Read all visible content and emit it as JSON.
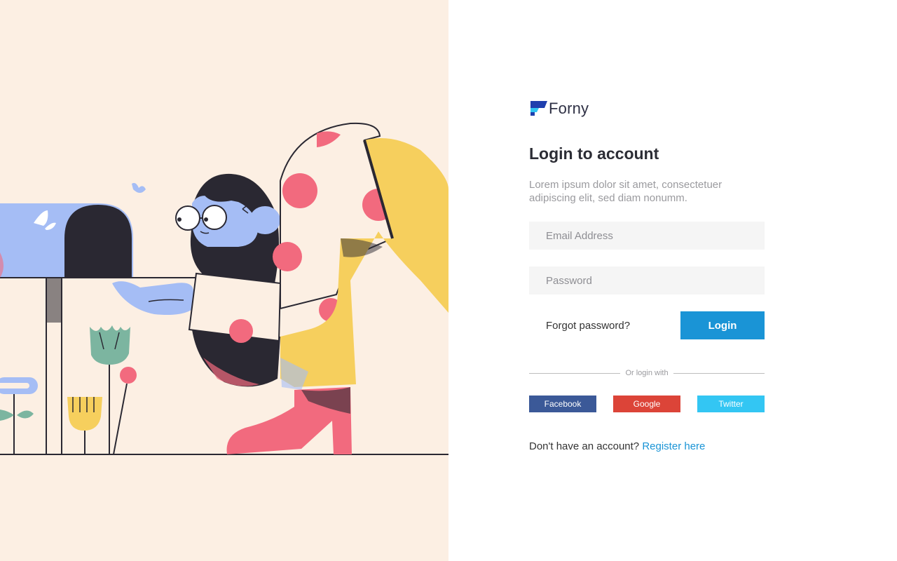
{
  "brand": {
    "name": "Forny",
    "colors": {
      "mark_dark": "#1f3fae",
      "mark_light": "#33c6f3",
      "text": "#2f3145"
    }
  },
  "login": {
    "title": "Login to account",
    "subtitle": "Lorem ipsum dolor sit amet, consectetuer adipiscing elit, sed diam nonumm.",
    "email": {
      "placeholder": "Email Address",
      "value": ""
    },
    "password": {
      "placeholder": "Password",
      "value": ""
    },
    "forgot_label": "Forgot password?",
    "login_label": "Login",
    "divider_label": "Or login with",
    "social": {
      "facebook": "Facebook",
      "google": "Google",
      "twitter": "Twitter"
    },
    "register_prompt": "Don't have an account?",
    "register_label": "Register here"
  },
  "colors": {
    "illustration_bg": "#fcefe3",
    "accent": "#1a94d6",
    "facebook": "#3b5998",
    "google": "#dc4438",
    "twitter": "#33c6f3",
    "input_bg": "#f5f5f5"
  },
  "illustration": {
    "subject": "woman-sending-mail-illustration"
  }
}
